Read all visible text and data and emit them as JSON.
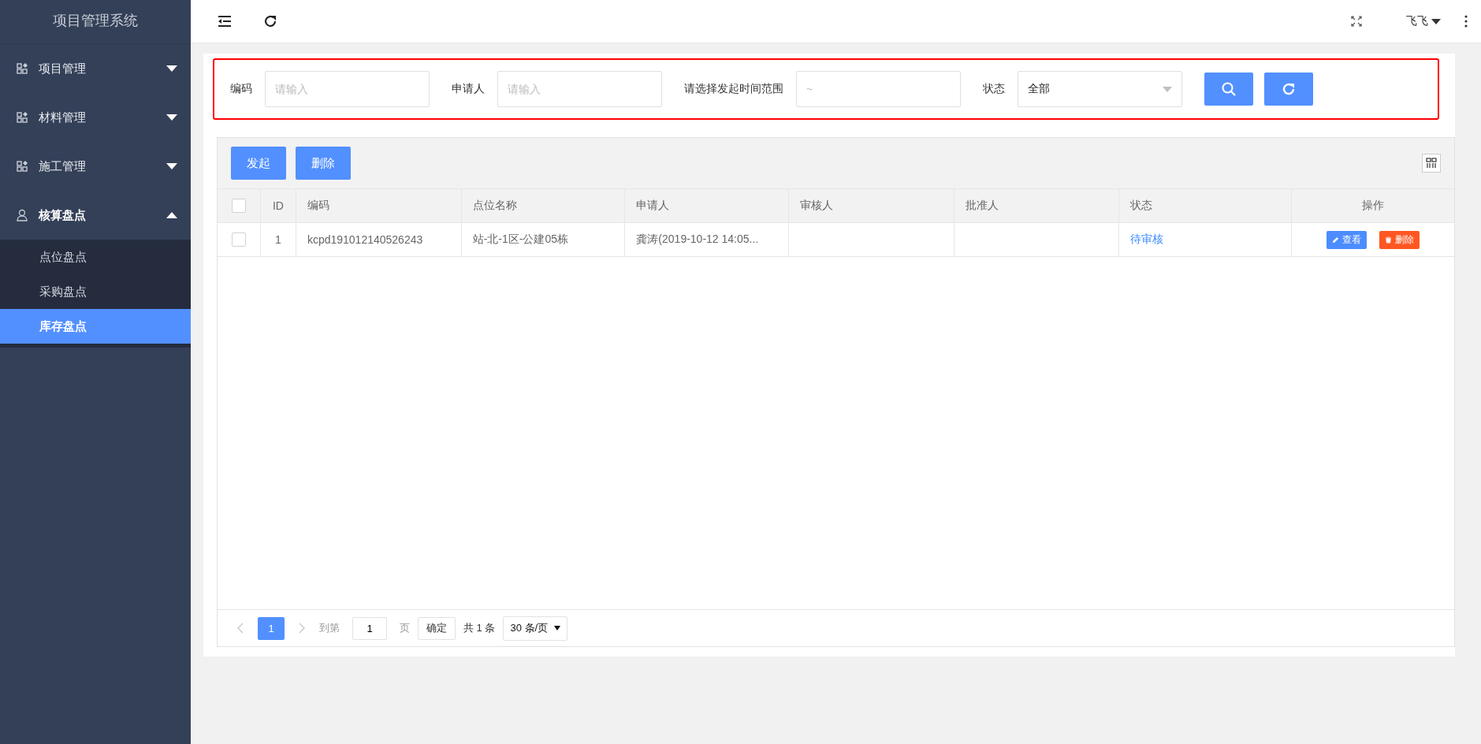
{
  "sidebar": {
    "title": "项目管理系统",
    "items": [
      {
        "label": "项目管理",
        "kind": "module",
        "expanded": false
      },
      {
        "label": "材料管理",
        "kind": "module",
        "expanded": false
      },
      {
        "label": "施工管理",
        "kind": "module",
        "expanded": false
      },
      {
        "label": "核算盘点",
        "kind": "account",
        "expanded": true,
        "children": [
          {
            "label": "点位盘点",
            "selected": false
          },
          {
            "label": "采购盘点",
            "selected": false
          },
          {
            "label": "库存盘点",
            "selected": true
          }
        ]
      }
    ]
  },
  "header": {
    "user": "飞飞"
  },
  "filters": {
    "fields": [
      {
        "kind": "input",
        "label": "编码",
        "placeholder": "请输入"
      },
      {
        "kind": "input",
        "label": "申请人",
        "placeholder": "请输入"
      },
      {
        "kind": "input",
        "label": "请选择发起时间范围",
        "placeholder": "~"
      },
      {
        "kind": "select",
        "label": "状态",
        "value": "全部"
      }
    ]
  },
  "toolbar": {
    "buttons": [
      "发起",
      "删除"
    ]
  },
  "table": {
    "columns": [
      "ID",
      "编码",
      "点位名称",
      "申请人",
      "审核人",
      "批准人",
      "状态",
      "操作"
    ],
    "header_checked": false,
    "rows": [
      {
        "checked": false,
        "cells": [
          "1",
          "kcpd191012140526243",
          "站-北-1区-公建05栋",
          "龚涛(2019-10-12 14:05...",
          "",
          ""
        ],
        "status": "待审核",
        "actions": [
          {
            "kind": "view",
            "label": "查看"
          },
          {
            "kind": "delete",
            "label": "删除"
          }
        ]
      }
    ]
  },
  "pagination": {
    "pages": [
      {
        "label": "1",
        "selected": true
      }
    ],
    "goto_label": "到第",
    "goto_value": "1",
    "page_unit": "页",
    "confirm": "确定",
    "total": "共 1 条",
    "page_size": "30 条/页"
  }
}
